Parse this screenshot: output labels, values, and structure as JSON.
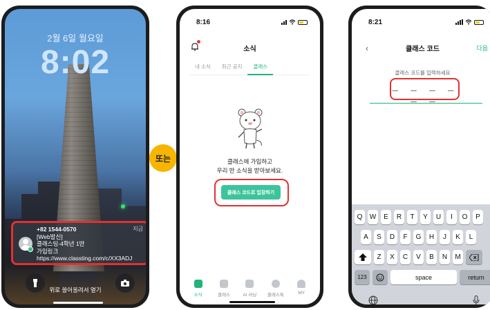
{
  "lockscreen": {
    "date": "2월 6일 월요일",
    "time": "8:02",
    "notification": {
      "sender": "+82 1544-0570",
      "time": "지금",
      "lines": [
        "[Web발신]",
        "클래스팅-4학년 1반",
        "가입링크",
        "https://www.classting.com/c/XX3ADJ"
      ]
    },
    "unlock_hint": "위로 쓸어올려서 열기",
    "flashlight_icon": "flashlight-icon",
    "camera_icon": "camera-icon"
  },
  "or_badge": "또는",
  "news_screen": {
    "status_time": "8:16",
    "title": "소식",
    "tabs": [
      {
        "label": "내 소식",
        "active": false
      },
      {
        "label": "최근 공지",
        "active": false
      },
      {
        "label": "클래스",
        "active": true
      }
    ],
    "message_lines": [
      "클래스에 가입하고",
      "우리 반 소식을 받아보세요."
    ],
    "join_button": "클래스 코드로 입장하기",
    "nav": [
      {
        "label": "소식",
        "icon": "news-icon",
        "active": true
      },
      {
        "label": "클래스",
        "icon": "grid-icon",
        "active": false
      },
      {
        "label": "AI 러닝",
        "icon": "ai-learning-icon",
        "active": false
      },
      {
        "label": "클래스톡",
        "icon": "chat-icon",
        "active": false
      },
      {
        "label": "MY",
        "icon": "person-icon",
        "active": false
      }
    ]
  },
  "code_screen": {
    "status_time": "8:21",
    "title": "클래스 코드",
    "next_label": "다음",
    "prompt": "클래스 코드를 입력하세요",
    "code_placeholder": "_ _ _ _ _ _",
    "keyboard": {
      "row1": [
        "Q",
        "W",
        "E",
        "R",
        "T",
        "Y",
        "U",
        "I",
        "O",
        "P"
      ],
      "row2": [
        "A",
        "S",
        "D",
        "F",
        "G",
        "H",
        "J",
        "K",
        "L"
      ],
      "row3": [
        "Z",
        "X",
        "C",
        "V",
        "B",
        "N",
        "M"
      ],
      "numbers_key": "123",
      "space_key": "space",
      "return_key": "return"
    }
  },
  "colors": {
    "accent_green": "#20b47a",
    "button_green": "#3dc49a",
    "highlight_red": "#e3302f",
    "badge_yellow": "#f7b500"
  }
}
